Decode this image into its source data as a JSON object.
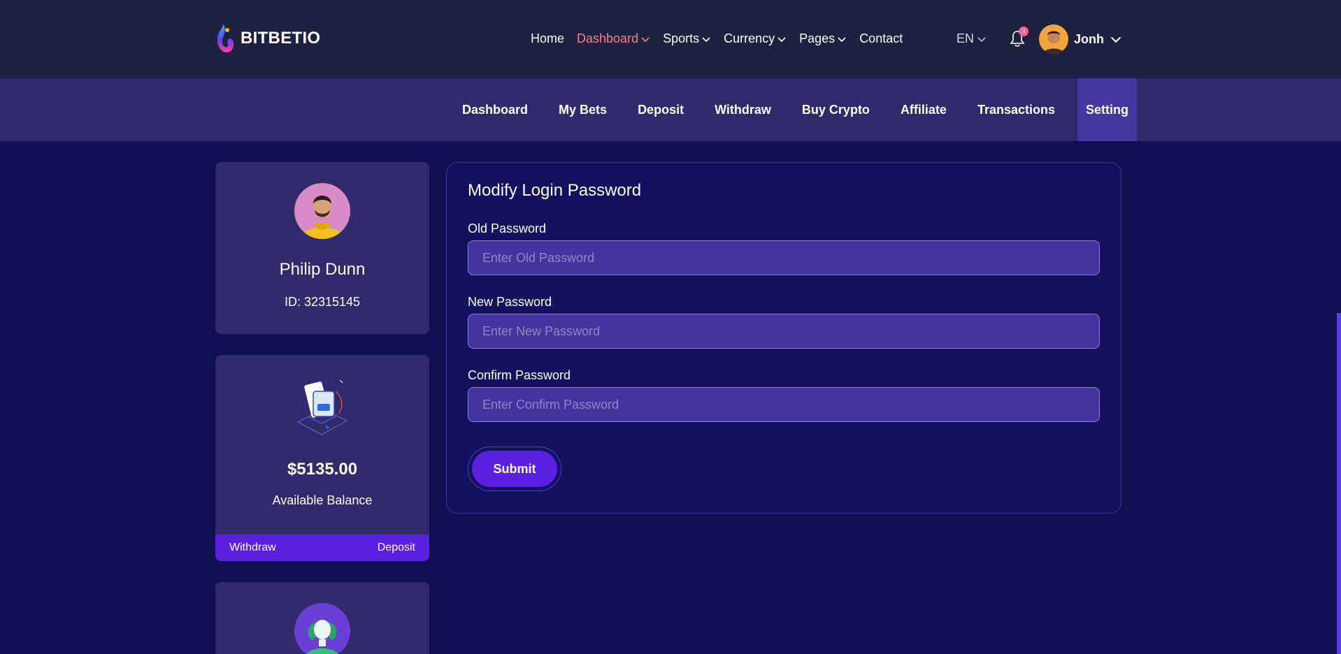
{
  "brand": {
    "name": "BITBETIO"
  },
  "nav": {
    "items": [
      {
        "label": "Home",
        "dropdown": false
      },
      {
        "label": "Dashboard",
        "dropdown": true,
        "active": true
      },
      {
        "label": "Sports",
        "dropdown": true
      },
      {
        "label": "Currency",
        "dropdown": true
      },
      {
        "label": "Pages",
        "dropdown": true
      },
      {
        "label": "Contact",
        "dropdown": false
      }
    ],
    "language": "EN",
    "notification_count": "3",
    "user_name": "Jonh"
  },
  "subnav": {
    "items": [
      {
        "label": "Dashboard"
      },
      {
        "label": "My Bets"
      },
      {
        "label": "Deposit"
      },
      {
        "label": "Withdraw"
      },
      {
        "label": "Buy Crypto"
      },
      {
        "label": "Affiliate"
      },
      {
        "label": "Transactions"
      },
      {
        "label": "Setting",
        "active": true
      }
    ]
  },
  "profile": {
    "name": "Philip Dunn",
    "id_text": "ID: 32315145"
  },
  "balance": {
    "amount": "$5135.00",
    "label": "Available Balance",
    "withdraw_label": "Withdraw",
    "deposit_label": "Deposit"
  },
  "form": {
    "title": "Modify Login Password",
    "old_label": "Old Password",
    "old_placeholder": "Enter Old Password",
    "new_label": "New Password",
    "new_placeholder": "Enter New Password",
    "confirm_label": "Confirm Password",
    "confirm_placeholder": "Enter Confirm Password",
    "submit_label": "Submit"
  },
  "colors": {
    "background": "#110f52",
    "topbar": "#1f2140",
    "subnav": "#302a6c",
    "accent": "#5a20e0",
    "active_nav": "#ff7a8a"
  }
}
